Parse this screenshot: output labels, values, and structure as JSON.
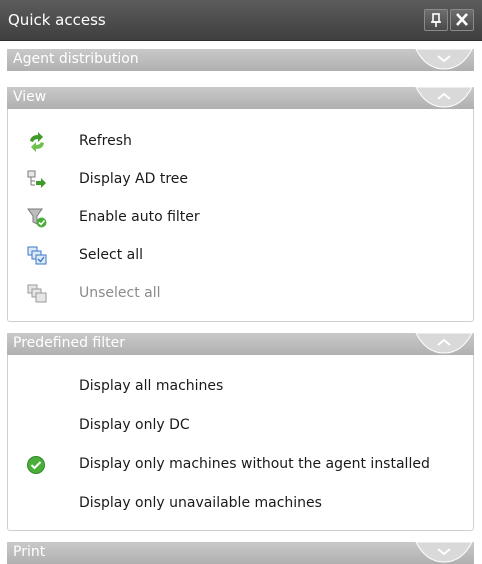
{
  "panel": {
    "title": "Quick access",
    "pin_glyph": "ᵖ",
    "close_glyph": "✕"
  },
  "sections": {
    "agent_distribution": {
      "label": "Agent distribution",
      "state": "collapsed"
    },
    "view": {
      "label": "View",
      "state": "expanded",
      "items": [
        {
          "label": "Refresh",
          "icon": "refresh-icon",
          "enabled": true
        },
        {
          "label": "Display AD tree",
          "icon": "ad-tree-icon",
          "enabled": true
        },
        {
          "label": "Enable auto filter",
          "icon": "filter-icon",
          "enabled": true
        },
        {
          "label": "Select all",
          "icon": "select-all-icon",
          "enabled": true
        },
        {
          "label": "Unselect all",
          "icon": "unselect-all-icon",
          "enabled": false
        }
      ]
    },
    "predefined_filter": {
      "label": "Predefined filter",
      "state": "expanded",
      "items": [
        {
          "label": "Display all machines",
          "checked": false
        },
        {
          "label": "Display only DC",
          "checked": false
        },
        {
          "label": "Display only machines without the agent installed",
          "checked": true
        },
        {
          "label": "Display only unavailable machines",
          "checked": false
        }
      ]
    },
    "print": {
      "label": "Print",
      "state": "collapsed"
    }
  },
  "colors": {
    "titlebar": "#4b4b4b",
    "section_header": "#bcbcbc",
    "refresh_green": "#3e9b2a",
    "check_green": "#4cae3a"
  }
}
